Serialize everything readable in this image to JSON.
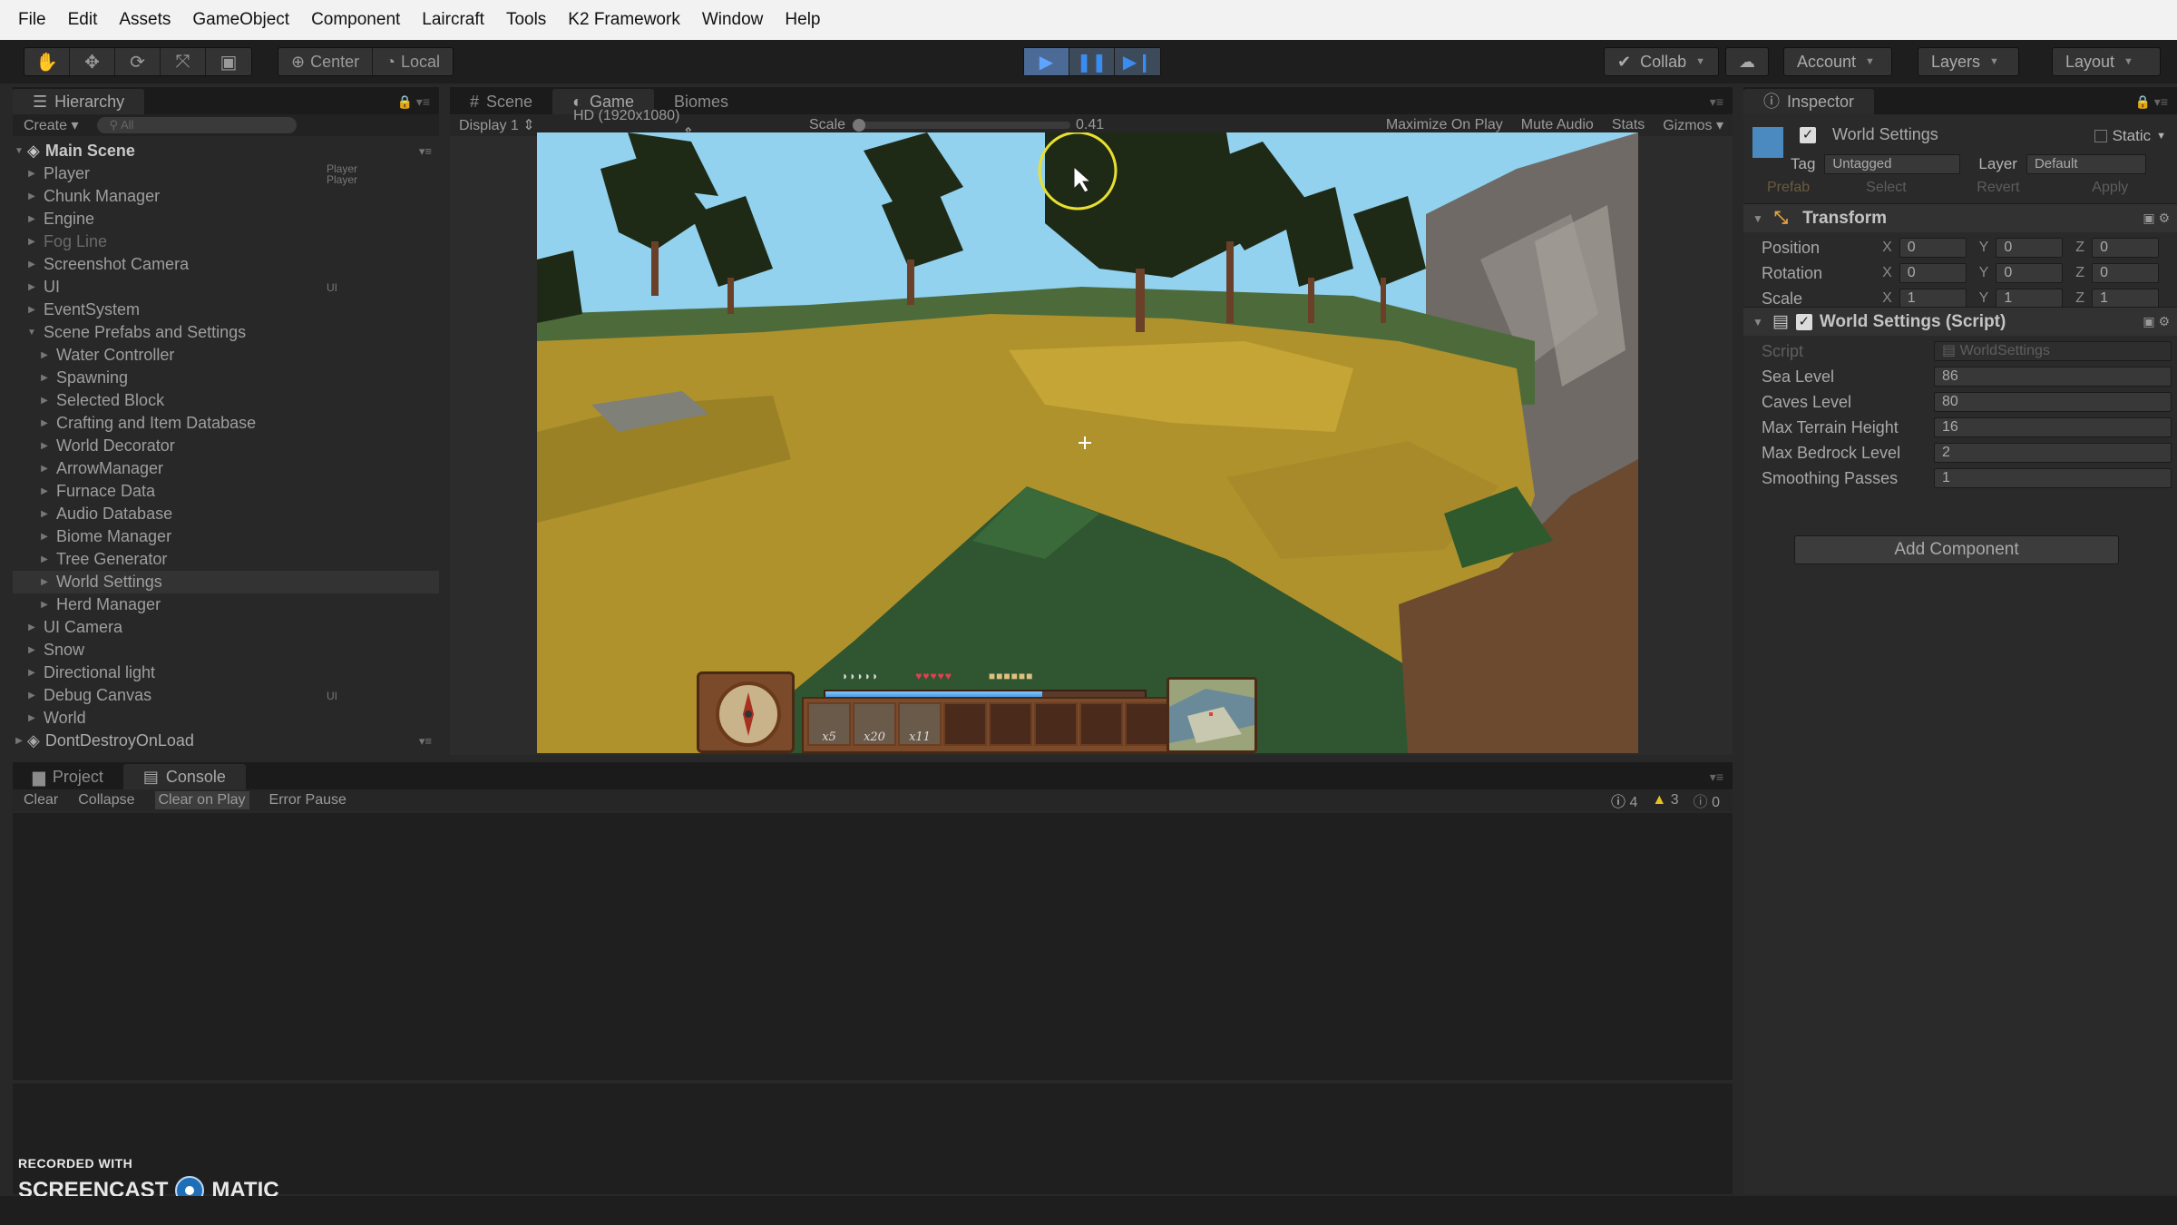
{
  "menu": [
    "File",
    "Edit",
    "Assets",
    "GameObject",
    "Component",
    "Laircraft",
    "Tools",
    "K2 Framework",
    "Window",
    "Help"
  ],
  "toolbar": {
    "pivot_label": "Center",
    "space_label": "Local",
    "collab_label": "Collab",
    "account_label": "Account",
    "layers_label": "Layers",
    "layout_label": "Layout",
    "play_active": true
  },
  "hierarchy": {
    "tab_label": "Hierarchy",
    "create_label": "Create",
    "search_placeholder": "All",
    "scene_name": "Main Scene",
    "items": [
      {
        "label": "Player",
        "indent": 1,
        "tag": "Player\nPlayer"
      },
      {
        "label": "Chunk Manager",
        "indent": 1
      },
      {
        "label": "Engine",
        "indent": 1
      },
      {
        "label": "Fog Line",
        "indent": 1,
        "dim": true
      },
      {
        "label": "Screenshot Camera",
        "indent": 1
      },
      {
        "label": "UI",
        "indent": 1,
        "tag": "UI"
      },
      {
        "label": "EventSystem",
        "indent": 1
      },
      {
        "label": "Scene Prefabs and Settings",
        "indent": 1,
        "expanded": true
      },
      {
        "label": "Water Controller",
        "indent": 2
      },
      {
        "label": "Spawning",
        "indent": 2
      },
      {
        "label": "Selected Block",
        "indent": 2
      },
      {
        "label": "Crafting and Item Database",
        "indent": 2
      },
      {
        "label": "World Decorator",
        "indent": 2
      },
      {
        "label": "ArrowManager",
        "indent": 2
      },
      {
        "label": "Furnace Data",
        "indent": 2
      },
      {
        "label": "Audio Database",
        "indent": 2
      },
      {
        "label": "Biome Manager",
        "indent": 2
      },
      {
        "label": "Tree Generator",
        "indent": 2
      },
      {
        "label": "World Settings",
        "indent": 2,
        "selected": true
      },
      {
        "label": "Herd Manager",
        "indent": 2
      },
      {
        "label": "UI Camera",
        "indent": 1
      },
      {
        "label": "Snow",
        "indent": 1
      },
      {
        "label": "Directional light",
        "indent": 1
      },
      {
        "label": "Debug Canvas",
        "indent": 1,
        "tag": "UI"
      },
      {
        "label": "World",
        "indent": 1
      }
    ],
    "second_scene": "DontDestroyOnLoad"
  },
  "views": {
    "tabs": [
      "Scene",
      "Game",
      "Biomes"
    ],
    "active_tab": "Game",
    "display": "Display 1",
    "resolution": "HD (1920x1080)",
    "scale_label": "Scale",
    "scale_value": "0.41",
    "maximize_label": "Maximize On Play",
    "mute_label": "Mute Audio",
    "stats_label": "Stats",
    "gizmos_label": "Gizmos"
  },
  "hud": {
    "hearts": 5,
    "armor": 5,
    "hunger": 6,
    "xp_fraction": 0.68,
    "slots": [
      "x5",
      "x20",
      "x11",
      "",
      "",
      "",
      "",
      ""
    ]
  },
  "inspector": {
    "tab_label": "Inspector",
    "object_name": "World Settings",
    "static_label": "Static",
    "tag_label": "Tag",
    "tag_value": "Untagged",
    "layer_label": "Layer",
    "layer_value": "Default",
    "prefab_label": "Prefab",
    "select_label": "Select",
    "revert_label": "Revert",
    "apply_label": "Apply",
    "transform": {
      "title": "Transform",
      "rows": [
        {
          "label": "Position",
          "x": "0",
          "y": "0",
          "z": "0"
        },
        {
          "label": "Rotation",
          "x": "0",
          "y": "0",
          "z": "0"
        },
        {
          "label": "Scale",
          "x": "1",
          "y": "1",
          "z": "1"
        }
      ]
    },
    "script_component": {
      "title": "World Settings (Script)",
      "script_label": "Script",
      "script_value": "WorldSettings",
      "fields": [
        {
          "label": "Sea Level",
          "value": "86"
        },
        {
          "label": "Caves Level",
          "value": "80"
        },
        {
          "label": "Max Terrain Height",
          "value": "16"
        },
        {
          "label": "Max Bedrock Level",
          "value": "2"
        },
        {
          "label": "Smoothing Passes",
          "value": "1"
        }
      ]
    },
    "add_component": "Add Component"
  },
  "console": {
    "tabs": [
      "Project",
      "Console"
    ],
    "active_tab": "Console",
    "clear": "Clear",
    "collapse": "Collapse",
    "clear_on_play": "Clear on Play",
    "error_pause": "Error Pause",
    "info_count": "4",
    "warning_count": "3",
    "error_count": "0"
  },
  "watermark": {
    "top": "RECORDED WITH",
    "left": "SCREENCAST",
    "right": "MATIC"
  },
  "colors": {
    "sky": "#8fd0f0",
    "grass_yellow": "#b89a2a",
    "grass_green": "#2f5a32",
    "dirt": "#6b4a30",
    "play_blue": "#3a8cf0",
    "cursor_ring": "#e8e030"
  }
}
